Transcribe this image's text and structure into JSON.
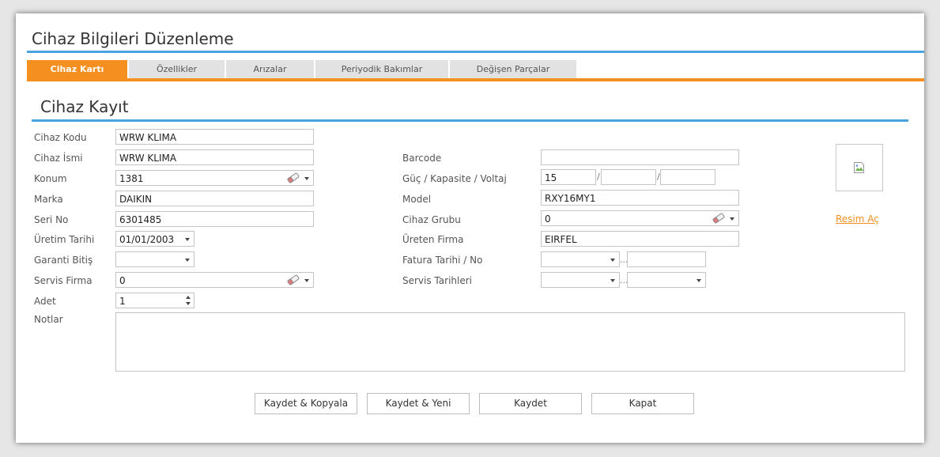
{
  "window": {
    "title": "Cihaz Bilgileri Düzenleme",
    "accent_orange": "#f58f1f",
    "accent_blue": "#4aa3df"
  },
  "tabs": [
    {
      "label": "Cihaz Kartı",
      "active": true
    },
    {
      "label": "Özellikler",
      "active": false
    },
    {
      "label": "Arızalar",
      "active": false
    },
    {
      "label": "Periyodik Bakımlar",
      "active": false
    },
    {
      "label": "Değişen Parçalar",
      "active": false
    }
  ],
  "section": {
    "title": "Cihaz Kayıt"
  },
  "left_fields": {
    "cihaz_kodu": {
      "label": "Cihaz Kodu",
      "value": "WRW KLIMA"
    },
    "cihaz_ismi": {
      "label": "Cihaz İsmi",
      "value": "WRW KLIMA"
    },
    "konum": {
      "label": "Konum",
      "value": "1381"
    },
    "marka": {
      "label": "Marka",
      "value": "DAIKIN"
    },
    "seri_no": {
      "label": "Seri No",
      "value": "6301485"
    },
    "uretim_tarihi": {
      "label": "Üretim Tarihi",
      "value": "01/01/2003"
    },
    "garanti_bitis": {
      "label": "Garanti Bitiş",
      "value": ""
    },
    "servis_firma": {
      "label": "Servis Firma",
      "value": "0"
    },
    "adet": {
      "label": "Adet",
      "value": "1"
    },
    "notlar": {
      "label": "Notlar",
      "value": ""
    }
  },
  "right_fields": {
    "barcode": {
      "label": "Barcode",
      "value": ""
    },
    "guc": {
      "label": "Güç / Kapasite / Voltaj",
      "value1": "15",
      "value2": "",
      "value3": "",
      "separator": "/"
    },
    "model": {
      "label": "Model",
      "value": "RXY16MY1"
    },
    "cihaz_grubu": {
      "label": "Cihaz Grubu",
      "value": "0"
    },
    "ureten_firma": {
      "label": "Üreten Firma",
      "value": "EIRFEL"
    },
    "fatura": {
      "label": "Fatura Tarihi / No",
      "date": "",
      "no": "",
      "separator": "..."
    },
    "servis_tarihleri": {
      "label": "Servis Tarihleri",
      "start": "",
      "end": "",
      "separator": "..."
    }
  },
  "image": {
    "link_label": "Resim Aç",
    "icon": "broken-image-icon"
  },
  "buttons": {
    "save_copy": "Kaydet & Kopyala",
    "save_new": "Kaydet & Yeni",
    "save": "Kaydet",
    "close": "Kapat"
  }
}
